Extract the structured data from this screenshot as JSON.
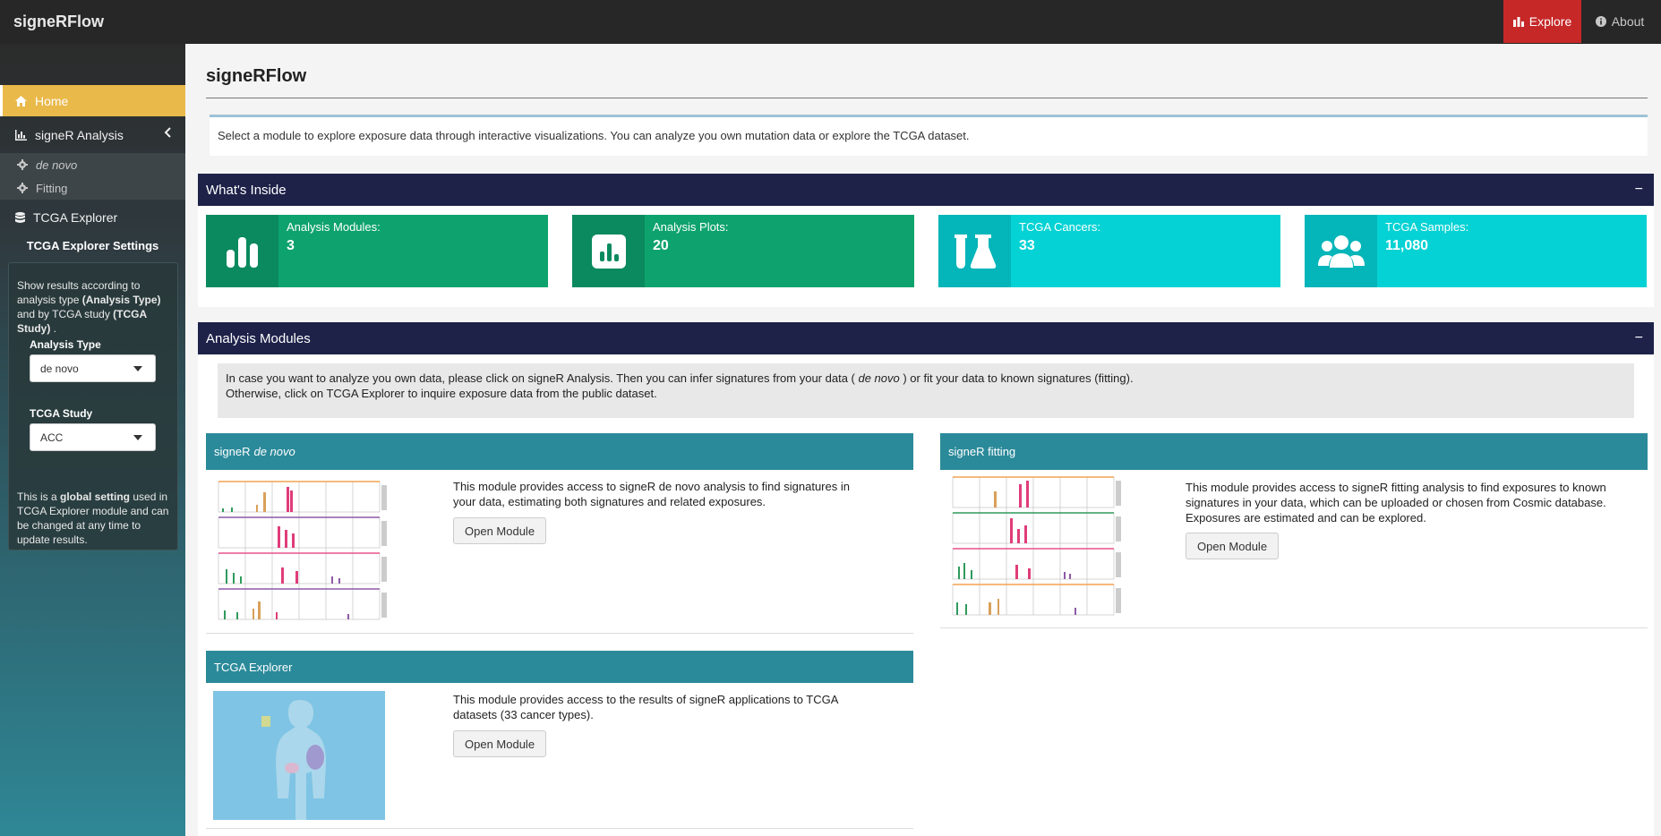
{
  "navbar": {
    "brand": "signeRFlow",
    "explore_label": "Explore",
    "about_label": "About"
  },
  "sidebar": {
    "items": [
      {
        "label": "Home",
        "icon": "home-icon",
        "active": true
      },
      {
        "label": "signeR Analysis",
        "icon": "chart-icon"
      },
      {
        "label": "TCGA Explorer",
        "icon": "database-icon"
      }
    ],
    "subitems": [
      {
        "label": "de novo",
        "icon": "gear-icon"
      },
      {
        "label": "Fitting",
        "icon": "gear-icon"
      }
    ],
    "settings_title": "TCGA Explorer Settings",
    "settings_desc_1": "Show results according to analysis type ",
    "settings_desc_b1": "(Analysis Type)",
    "settings_desc_2": " and by TCGA study ",
    "settings_desc_b2": "(TCGA Study)",
    "settings_desc_3": " .",
    "analysis_type_label": "Analysis Type",
    "analysis_type_value": "de novo",
    "tcga_study_label": "TCGA Study",
    "tcga_study_value": "ACC",
    "note_1": "This is a ",
    "note_b": "global setting",
    "note_2": " used in TCGA Explorer module and can be changed at any time to update results."
  },
  "main": {
    "page_title": "signeRFlow",
    "intro": "Select a module to explore exposure data through interactive visualizations. You can analyze you own mutation data or explore the TCGA dataset.",
    "whats_inside": {
      "title": "What's Inside",
      "collapse": "−",
      "stats": [
        {
          "label": "Analysis Modules:",
          "value": "3",
          "icon": "bar-chart-icon",
          "color": "#0ea36e"
        },
        {
          "label": "Analysis Plots:",
          "value": "20",
          "icon": "poll-icon",
          "color": "#0ea36e"
        },
        {
          "label": "TCGA Cancers:",
          "value": "33",
          "icon": "flask-icon",
          "color": "#05d2d4"
        },
        {
          "label": "TCGA Samples:",
          "value": "11,080",
          "icon": "users-icon",
          "color": "#05d2d4"
        }
      ]
    },
    "analysis_modules": {
      "title": "Analysis Modules",
      "collapse": "−",
      "callout_1": "In case you want to analyze you own data, please click on signeR Analysis. Then you can infer signatures from your data ( ",
      "callout_em": "de novo",
      "callout_2": " ) or fit your data to known signatures (fitting).",
      "callout_line2": "Otherwise, click on TCGA Explorer to inquire exposure data from the public dataset.",
      "modules": [
        {
          "title": "signeR",
          "title_em": "de novo",
          "text": "This module provides access to signeR de novo analysis to find signatures in your data, estimating both signatures and related exposures.",
          "button": "Open Module"
        },
        {
          "title": "signeR fitting",
          "title_em": "",
          "text": "This module provides access to signeR fitting analysis to find exposures to known signatures in your data, which can be uploaded or chosen from Cosmic database. Exposures are estimated and can be explored.",
          "button": "Open Module"
        },
        {
          "title": "TCGA Explorer",
          "title_em": "",
          "text": "This module provides access to the results of signeR applications to TCGA datasets (33 cancer types).",
          "button": "Open Module"
        }
      ]
    }
  },
  "colors": {
    "navbar": "#272727",
    "explore_active": "#c62828",
    "home_active": "#e9b949",
    "section_header": "#1e2249",
    "module_header": "#2b8a9a"
  }
}
